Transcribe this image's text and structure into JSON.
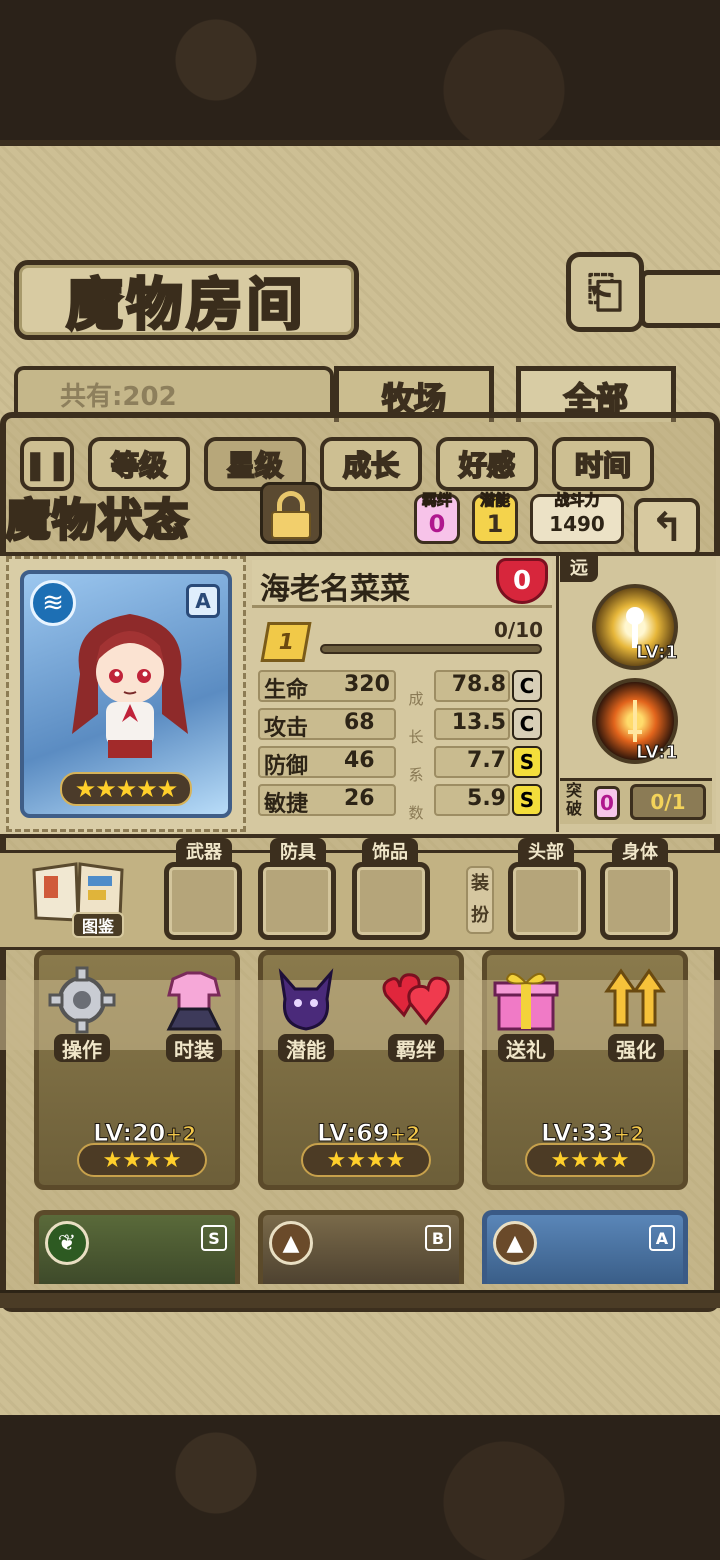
{
  "header": {
    "title": "魔物房间",
    "back_icon": "⎗"
  },
  "collection": {
    "count_text": "共有:202"
  },
  "top_tabs": [
    {
      "label": "牧场"
    },
    {
      "label": "全部"
    }
  ],
  "sort_buttons": [
    {
      "label": "等级"
    },
    {
      "label": "星级"
    },
    {
      "label": "成长"
    },
    {
      "label": "好感"
    },
    {
      "label": "时间"
    }
  ],
  "status": {
    "title": "魔物状态",
    "bond_label": "羁绊",
    "bond_value": "0",
    "potential_label": "潜能",
    "potential_value": "1",
    "power_label": "战斗力",
    "power_value": "1490",
    "return_icon": "↰"
  },
  "monster": {
    "name": "海老名菜菜",
    "affection": "0",
    "rank": "A",
    "element_icon": "≋",
    "stars": "★★★★★",
    "level": "1",
    "exp_text": "0/10",
    "exp_fraction": 0.0,
    "stats": [
      {
        "label": "生命",
        "value": "320",
        "growth": "78.8",
        "grade": "C",
        "grade_color": "#d8cfb7"
      },
      {
        "label": "攻击",
        "value": "68",
        "growth": "13.5",
        "grade": "C",
        "grade_color": "#d8cfb7"
      },
      {
        "label": "防御",
        "value": "46",
        "growth": "7.7",
        "grade": "S",
        "grade_color": "#f4de3b"
      },
      {
        "label": "敏捷",
        "value": "26",
        "growth": "5.9",
        "grade": "S",
        "grade_color": "#f4de3b"
      }
    ],
    "growth_chars": [
      "成",
      "长",
      "系",
      "数"
    ]
  },
  "skills": {
    "range_label": "远",
    "items": [
      {
        "lv": "LV:1"
      },
      {
        "lv": "LV:1"
      }
    ],
    "breakthrough_label": "突破",
    "breakthrough_count": "0",
    "breakthrough_progress": "0/1"
  },
  "equipment": {
    "book_label": "图鉴",
    "dress_label": "装扮",
    "slots": [
      "武器",
      "防具",
      "饰品",
      "头部",
      "身体"
    ]
  },
  "actions": [
    {
      "label": "操作"
    },
    {
      "label": "时装"
    },
    {
      "label": "潜能"
    },
    {
      "label": "羁绊"
    },
    {
      "label": "送礼"
    },
    {
      "label": "强化"
    }
  ],
  "grid": [
    {
      "lv": "LV:20",
      "plus": "+2",
      "stars": "★★★★"
    },
    {
      "lv": "LV:69",
      "plus": "+2",
      "stars": "★★★★"
    },
    {
      "lv": "LV:33",
      "plus": "+2",
      "stars": "★★★★"
    }
  ],
  "grid_row2": [
    {
      "rank": "S",
      "badge": "❦"
    },
    {
      "rank": "B",
      "badge": "▲"
    },
    {
      "rank": "A",
      "badge": "▲"
    }
  ]
}
